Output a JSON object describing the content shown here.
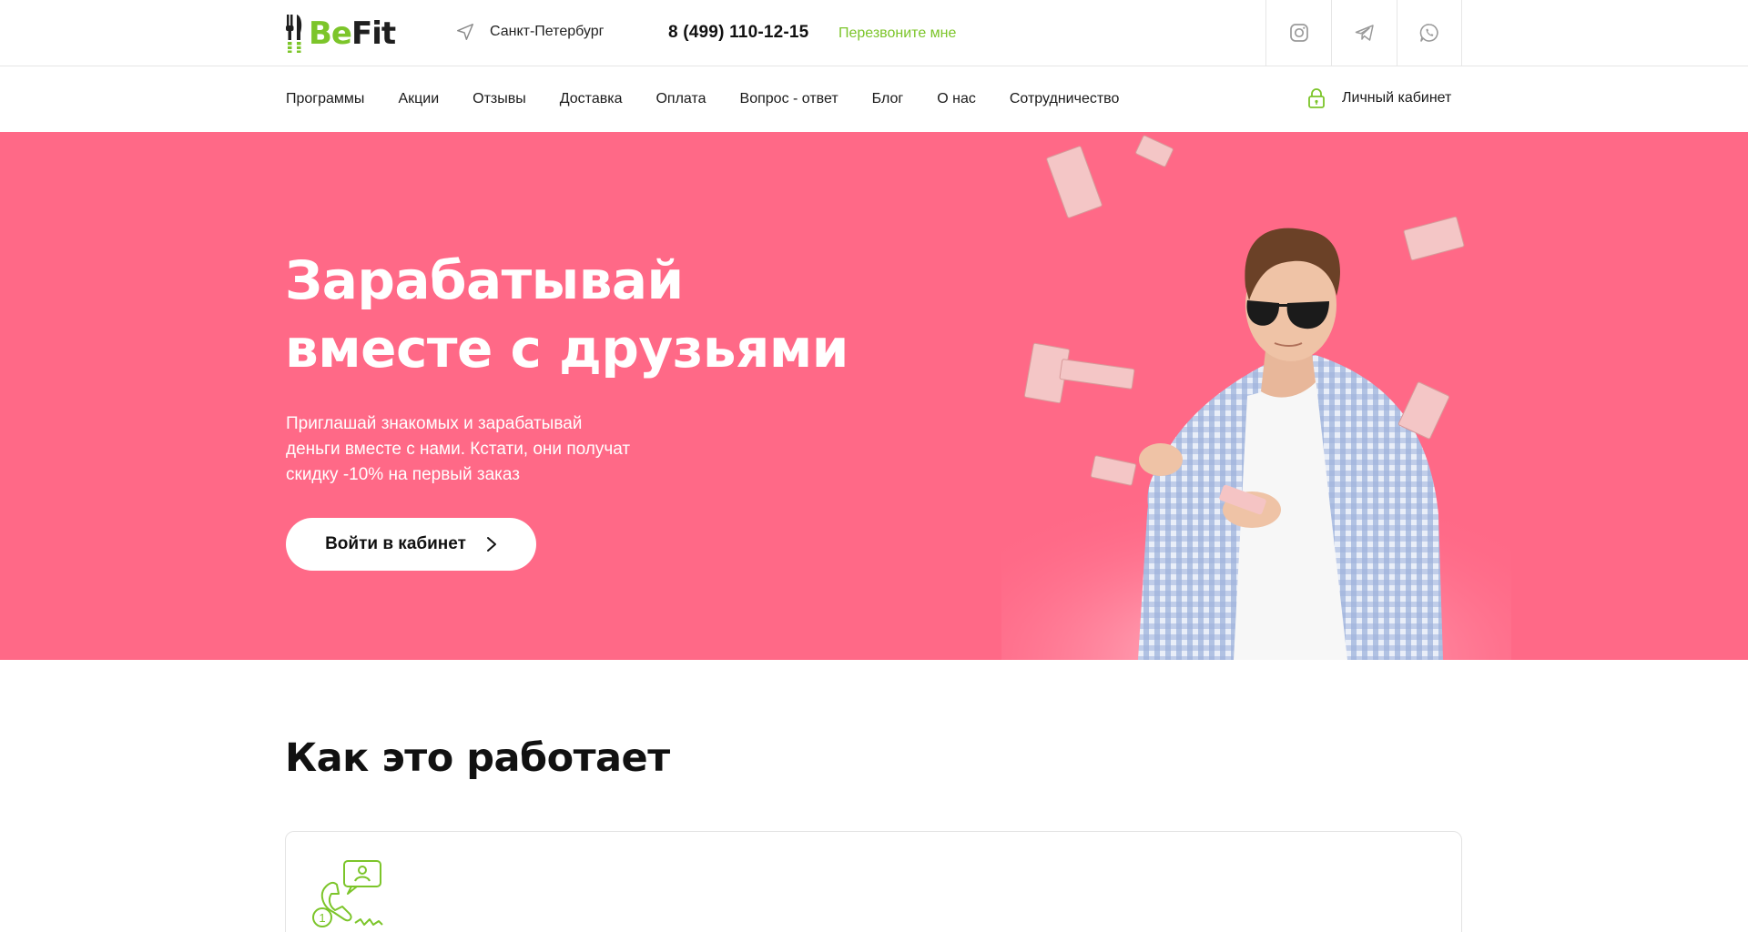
{
  "header": {
    "logo": {
      "be": "Be",
      "fit": "Fit"
    },
    "city": "Санкт-Петербург",
    "phone": "8 (499) 110-12-15",
    "callback_label": "Перезвоните мне",
    "social_icons": [
      "instagram-icon",
      "telegram-icon",
      "whatsapp-icon"
    ]
  },
  "nav": {
    "items": [
      {
        "label": "Программы"
      },
      {
        "label": "Акции"
      },
      {
        "label": "Отзывы"
      },
      {
        "label": "Доставка"
      },
      {
        "label": "Оплата"
      },
      {
        "label": "Вопрос - ответ"
      },
      {
        "label": "Блог"
      },
      {
        "label": "О нас"
      },
      {
        "label": "Сотрудничество"
      }
    ],
    "account_label": "Личный кабинет"
  },
  "hero": {
    "title_line1": "Зарабатывай",
    "title_line2": "вместе с друзьями",
    "text_line1": "Приглашай знакомых и зарабатывай",
    "text_line2": "деньги вместе с нами. Кстати, они получат",
    "text_line3": "скидку -10% на первый заказ",
    "button_label": "Войти в кабинет"
  },
  "how": {
    "title": "Как это работает",
    "step_badge": "1"
  },
  "colors": {
    "accent": "#7cc52a",
    "hero_bg": "#ff6987",
    "text": "#1a1a1a"
  }
}
